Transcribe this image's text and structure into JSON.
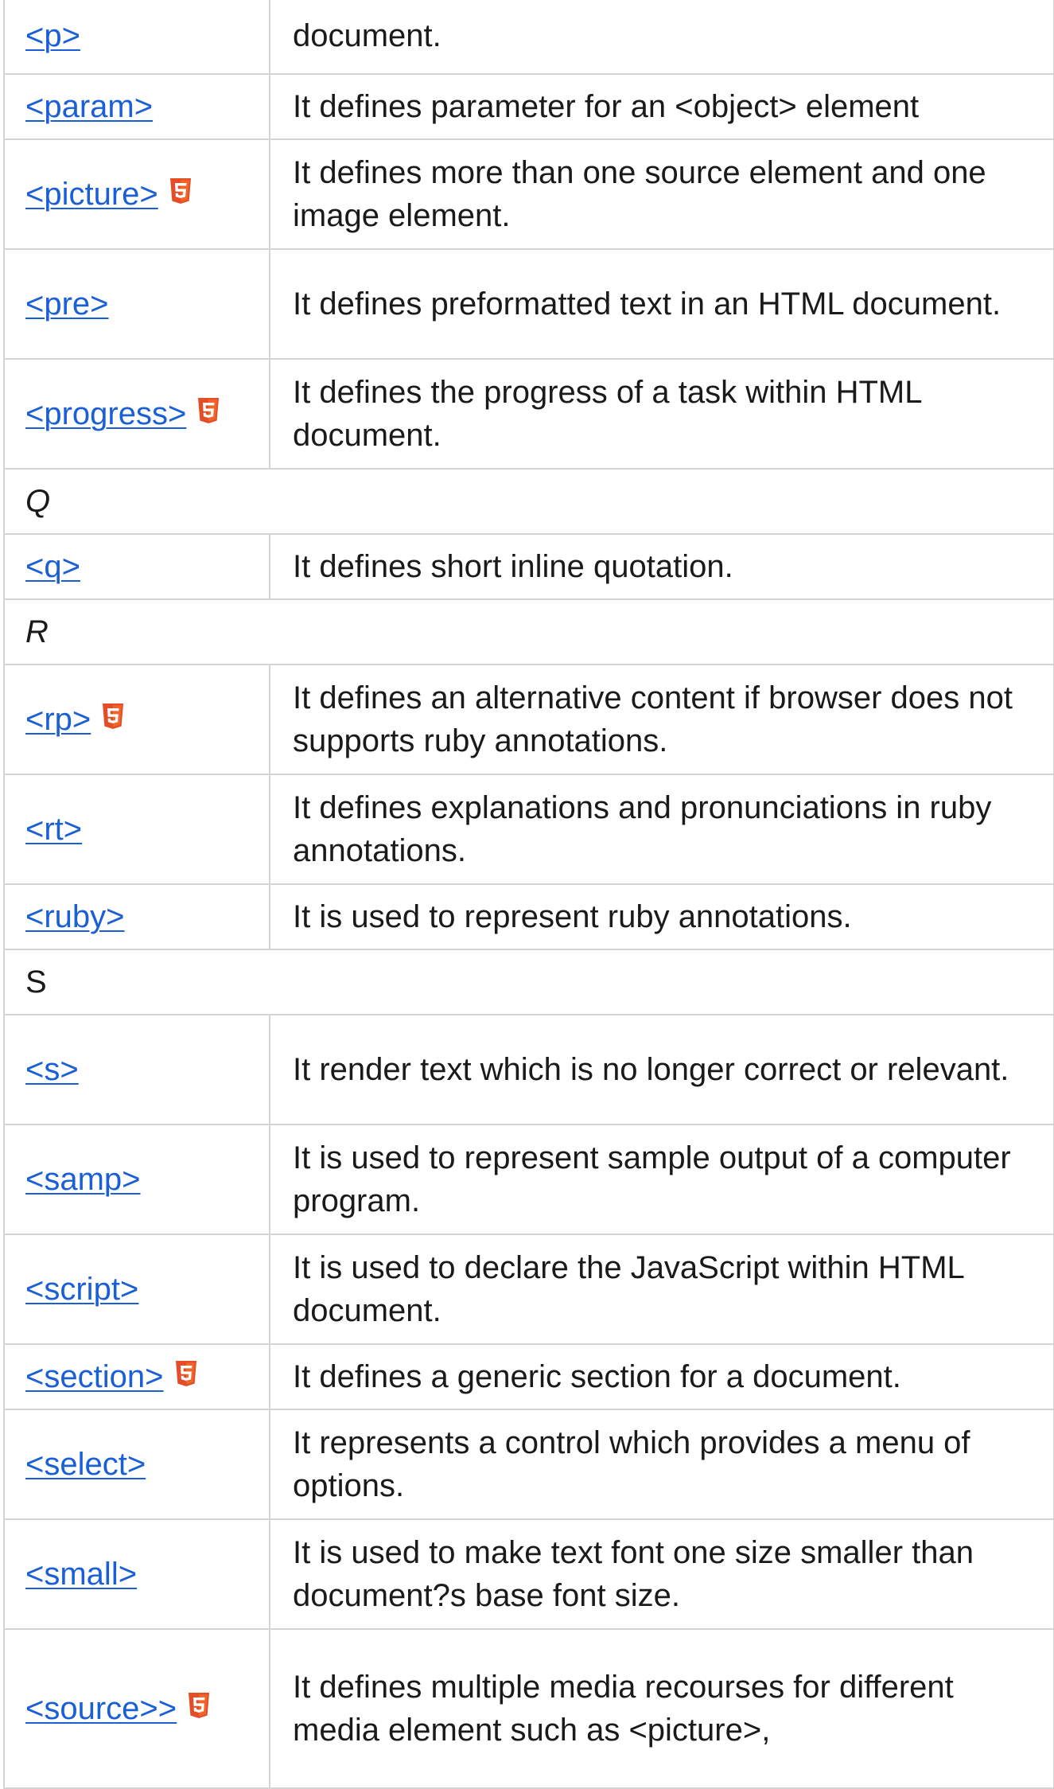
{
  "rows": [
    {
      "kind": "entry",
      "tag": "<p>",
      "html5": false,
      "desc": "document.",
      "h": 96
    },
    {
      "kind": "entry",
      "tag": "<param>",
      "html5": false,
      "desc": "It defines parameter for an <object> element",
      "h": 82
    },
    {
      "kind": "entry",
      "tag": "<picture>",
      "html5": true,
      "desc": "It defines more than one source element and one image element.",
      "h": 138
    },
    {
      "kind": "entry",
      "tag": "<pre>",
      "html5": false,
      "desc": "It defines preformatted text in an HTML document.",
      "h": 138
    },
    {
      "kind": "entry",
      "tag": "<progress>",
      "html5": true,
      "desc": "It defines the progress of a task within HTML document.",
      "h": 138
    },
    {
      "kind": "section",
      "label": "Q",
      "italic": true,
      "h": 82
    },
    {
      "kind": "entry",
      "tag": "<q>",
      "html5": false,
      "desc": "It defines short inline quotation.",
      "h": 82
    },
    {
      "kind": "section",
      "label": "R",
      "italic": true,
      "h": 82
    },
    {
      "kind": "entry",
      "tag": "<rp>",
      "html5": true,
      "desc": "It defines an alternative content if browser does not supports ruby annotations.",
      "h": 138
    },
    {
      "kind": "entry",
      "tag": "<rt>",
      "html5": false,
      "desc": "It defines explanations and pronunciations in ruby annotations.",
      "h": 138
    },
    {
      "kind": "entry",
      "tag": "<ruby>",
      "html5": false,
      "desc": "It is used to represent ruby annotations.",
      "h": 82
    },
    {
      "kind": "section",
      "label": "S",
      "italic": false,
      "h": 82
    },
    {
      "kind": "entry",
      "tag": "<s>",
      "html5": false,
      "desc": "It render text which is no longer correct or relevant.",
      "h": 138
    },
    {
      "kind": "entry",
      "tag": "<samp>",
      "html5": false,
      "desc": "It is used to represent sample output of a computer program.",
      "h": 138
    },
    {
      "kind": "entry",
      "tag": "<script>",
      "html5": false,
      "desc": "It is used to declare the JavaScript within HTML document.",
      "h": 138
    },
    {
      "kind": "entry",
      "tag": "<section>",
      "html5": true,
      "desc": "It defines a generic section for a document.",
      "h": 82
    },
    {
      "kind": "entry",
      "tag": "<select>",
      "html5": false,
      "desc": "It represents a control which provides a menu of options.",
      "h": 138
    },
    {
      "kind": "entry",
      "tag": "<small>",
      "html5": false,
      "desc": "It is used to make text font one size smaller than document?s base font size.",
      "h": 138
    },
    {
      "kind": "entry",
      "tag": "<source>>",
      "html5": true,
      "desc": "It defines multiple media recourses for different media element such as <picture>,",
      "h": 200
    }
  ]
}
